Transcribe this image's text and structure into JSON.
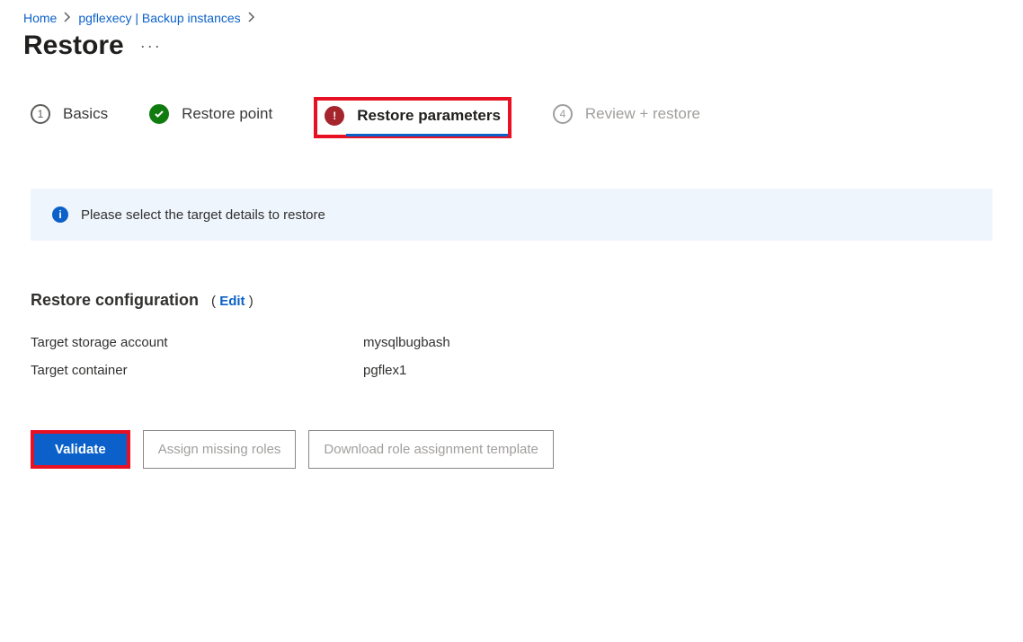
{
  "breadcrumb": {
    "home": "Home",
    "current": "pgflexecy | Backup instances"
  },
  "page": {
    "title": "Restore",
    "more": "···"
  },
  "tabs": {
    "basics": "Basics",
    "restore_point": "Restore point",
    "restore_params": "Restore parameters",
    "review": "Review + restore",
    "step1": "1",
    "step4": "4"
  },
  "info": {
    "message": "Please select the target details to restore"
  },
  "config": {
    "heading": "Restore configuration",
    "edit": "Edit",
    "fields": {
      "storage_label": "Target storage account",
      "storage_value": "mysqlbugbash",
      "container_label": "Target container",
      "container_value": "pgflex1"
    }
  },
  "actions": {
    "validate": "Validate",
    "assign": "Assign missing roles",
    "download": "Download role assignment template"
  }
}
